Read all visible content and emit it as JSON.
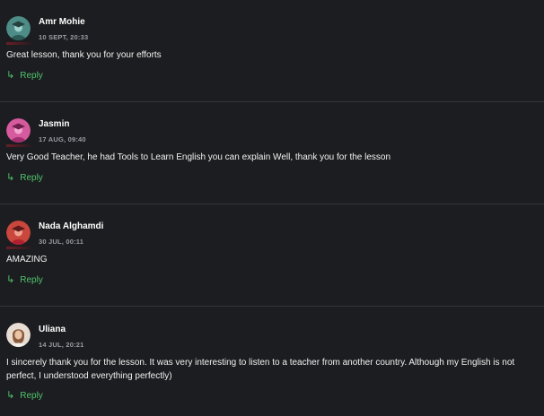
{
  "comments": [
    {
      "name": "Amr Mohie",
      "date": "10 SEPT, 20:33",
      "text": "Great lesson, thank you for your efforts",
      "reply": "Reply",
      "avatar_color": "#4e8c87"
    },
    {
      "name": "Jasmin",
      "date": "17 AUG, 09:40",
      "text": "Very Good Teacher, he had Tools to Learn English you can explain Well, thank you for the lesson",
      "reply": "Reply",
      "avatar_color": "#d65a9e"
    },
    {
      "name": "Nada Alghamdi",
      "date": "30 JUL, 00:11",
      "text": "AMAZING",
      "reply": "Reply",
      "avatar_color": "#c9473c"
    },
    {
      "name": "Uliana",
      "date": "14 JUL, 20:21",
      "text": "I sincerely thank you for the lesson. It was very interesting to listen to a teacher from another country. Although my English is not perfect, I understood everything perfectly)",
      "reply": "Reply",
      "avatar_color": "#c8a58a"
    }
  ],
  "colors": {
    "background": "#1c1d20",
    "reply": "#4fc36b",
    "date": "#9a9ca3",
    "divider": "#34363b"
  }
}
